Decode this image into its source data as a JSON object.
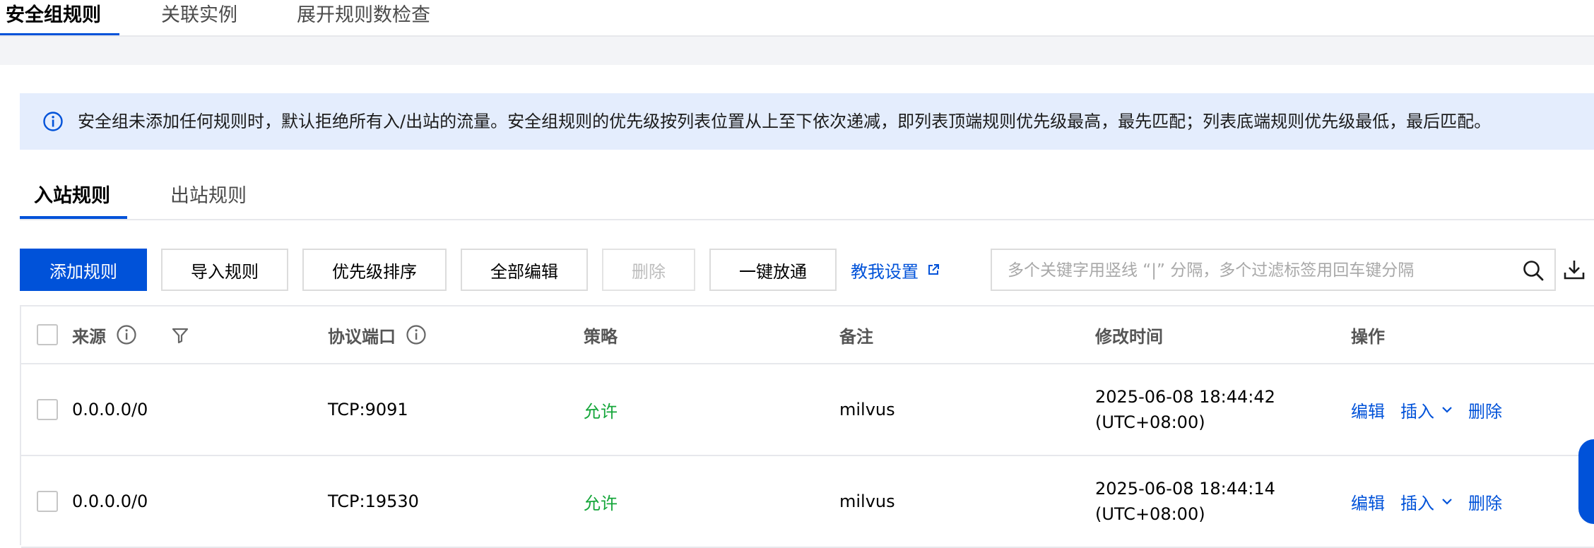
{
  "top_tabs": [
    {
      "label": "安全组规则",
      "active": true
    },
    {
      "label": "关联实例",
      "active": false
    },
    {
      "label": "展开规则数检查",
      "active": false
    }
  ],
  "info_banner": {
    "icon": "info-icon",
    "text": "安全组未添加任何规则时，默认拒绝所有入/出站的流量。安全组规则的优先级按列表位置从上至下依次递减，即列表顶端规则优先级最高，最先匹配；列表底端规则优先级最低，最后匹配。"
  },
  "rule_tabs": [
    {
      "label": "入站规则",
      "active": true
    },
    {
      "label": "出站规则",
      "active": false
    }
  ],
  "toolbar": {
    "add_rule": "添加规则",
    "import_rules": "导入规则",
    "priority_sort": "优先级排序",
    "edit_all": "全部编辑",
    "delete": "删除",
    "one_click_open": "一键放通",
    "teach_me": "教我设置",
    "search_placeholder": "多个关键字用竖线 “|” 分隔，多个过滤标签用回车键分隔"
  },
  "table": {
    "columns": {
      "source": "来源",
      "protocol_port": "协议端口",
      "policy": "策略",
      "remark": "备注",
      "modified_time": "修改时间",
      "actions": "操作"
    },
    "rows": [
      {
        "source": "0.0.0.0/0",
        "protocol_port": "TCP:9091",
        "policy": "允许",
        "remark": "milvus",
        "time": "2025-06-08 18:44:42",
        "timezone": "(UTC+08:00)"
      },
      {
        "source": "0.0.0.0/0",
        "protocol_port": "TCP:19530",
        "policy": "允许",
        "remark": "milvus",
        "time": "2025-06-08 18:44:14",
        "timezone": "(UTC+08:00)"
      }
    ],
    "actions": {
      "edit": "编辑",
      "insert": "插入",
      "delete": "删除"
    }
  },
  "colors": {
    "accent": "#0052d9",
    "allow": "#15a63a",
    "banner_bg": "#e4edfd"
  }
}
